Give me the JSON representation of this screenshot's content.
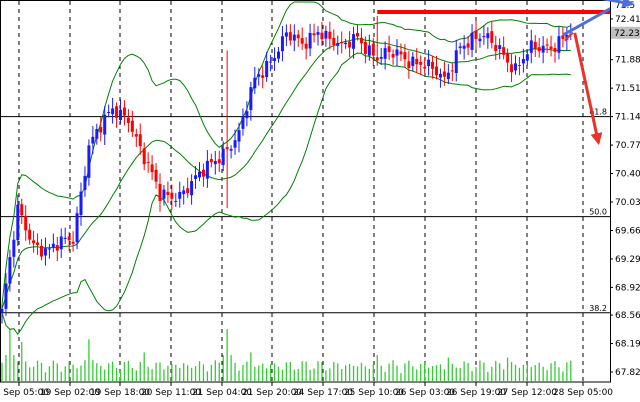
{
  "chart_data": {
    "type": "candlestick",
    "title": "",
    "xlabel": "",
    "ylabel": "",
    "ylim": [
      67.82,
      72.63
    ],
    "grid": true,
    "colors": {
      "background": "#ffffff",
      "bull": "#1a1aff",
      "bear": "#ff0000",
      "bands": "#008000",
      "volume": "#33cc33",
      "resistance": "#ff0000",
      "arrow_up": "#4f6fd8",
      "arrow_down": "#e8332a",
      "current_price_box": "#c0c0c0"
    },
    "y_ticks": [
      "72.410",
      "71.880",
      "71.510",
      "71.140",
      "70.770",
      "70.400",
      "70.030",
      "69.660",
      "69.290",
      "68.920",
      "68.560",
      "68.190",
      "67.820"
    ],
    "y_tick_values": [
      72.41,
      71.88,
      71.51,
      71.14,
      70.77,
      70.4,
      70.03,
      69.66,
      69.29,
      68.92,
      68.56,
      68.19,
      67.82
    ],
    "top_tick_label": "72.5",
    "current_price": {
      "label": "72.230",
      "value": 72.23
    },
    "x_ticks": [
      "18 Sep 05:00",
      "19 Sep 02:00",
      "19 Sep 18:00",
      "20 Sep 11:00",
      "21 Sep 04:00",
      "21 Sep 20:00",
      "24 Sep 17:00",
      "25 Sep 10:00",
      "26 Sep 03:00",
      "26 Sep 19:00",
      "27 Sep 12:00",
      "28 Sep 05:00"
    ],
    "fib_levels": [
      {
        "label": "61.8",
        "value": 71.14
      },
      {
        "label": "50.0",
        "value": 69.84
      },
      {
        "label": "38.2",
        "value": 68.59
      }
    ],
    "resistance_level": 72.5,
    "n_candles": 145,
    "anchors": [
      [
        0,
        68.6
      ],
      [
        4,
        69.9
      ],
      [
        8,
        69.5
      ],
      [
        12,
        69.4
      ],
      [
        18,
        69.55
      ],
      [
        22,
        70.8
      ],
      [
        28,
        71.2
      ],
      [
        32,
        71.15
      ],
      [
        36,
        70.6
      ],
      [
        40,
        70.1
      ],
      [
        45,
        70.15
      ],
      [
        50,
        70.35
      ],
      [
        56,
        70.7
      ],
      [
        60,
        70.9
      ],
      [
        64,
        71.6
      ],
      [
        68,
        71.9
      ],
      [
        72,
        72.2
      ],
      [
        76,
        72.05
      ],
      [
        80,
        72.3
      ],
      [
        86,
        72.0
      ],
      [
        90,
        72.2
      ],
      [
        95,
        71.9
      ],
      [
        100,
        71.95
      ],
      [
        106,
        71.85
      ],
      [
        112,
        71.6
      ],
      [
        116,
        72.1
      ],
      [
        122,
        72.15
      ],
      [
        126,
        72.05
      ],
      [
        130,
        71.75
      ],
      [
        134,
        72.0
      ],
      [
        140,
        72.1
      ],
      [
        144,
        72.23
      ]
    ],
    "spikes": [
      {
        "index": 57,
        "high": 72.0,
        "low": 69.95
      },
      {
        "index": 95,
        "high": 72.45,
        "low": 71.8
      }
    ],
    "volume_peaks": [
      {
        "index": 2,
        "value": 1.0
      },
      {
        "index": 5,
        "value": 0.75
      },
      {
        "index": 22,
        "value": 0.8
      },
      {
        "index": 36,
        "value": 0.55
      },
      {
        "index": 57,
        "value": 1.0
      },
      {
        "index": 63,
        "value": 0.55
      },
      {
        "index": 95,
        "value": 0.5
      },
      {
        "index": 113,
        "value": 0.45
      },
      {
        "index": 128,
        "value": 0.45
      }
    ],
    "arrows": [
      {
        "type": "up",
        "from": {
          "index": 142,
          "value": 72.2
        },
        "to": {
          "index": 157,
          "value": 72.63
        }
      },
      {
        "type": "down",
        "from": {
          "index": 145,
          "value": 72.23
        },
        "to": {
          "index": 151,
          "value": 70.8
        }
      }
    ]
  }
}
